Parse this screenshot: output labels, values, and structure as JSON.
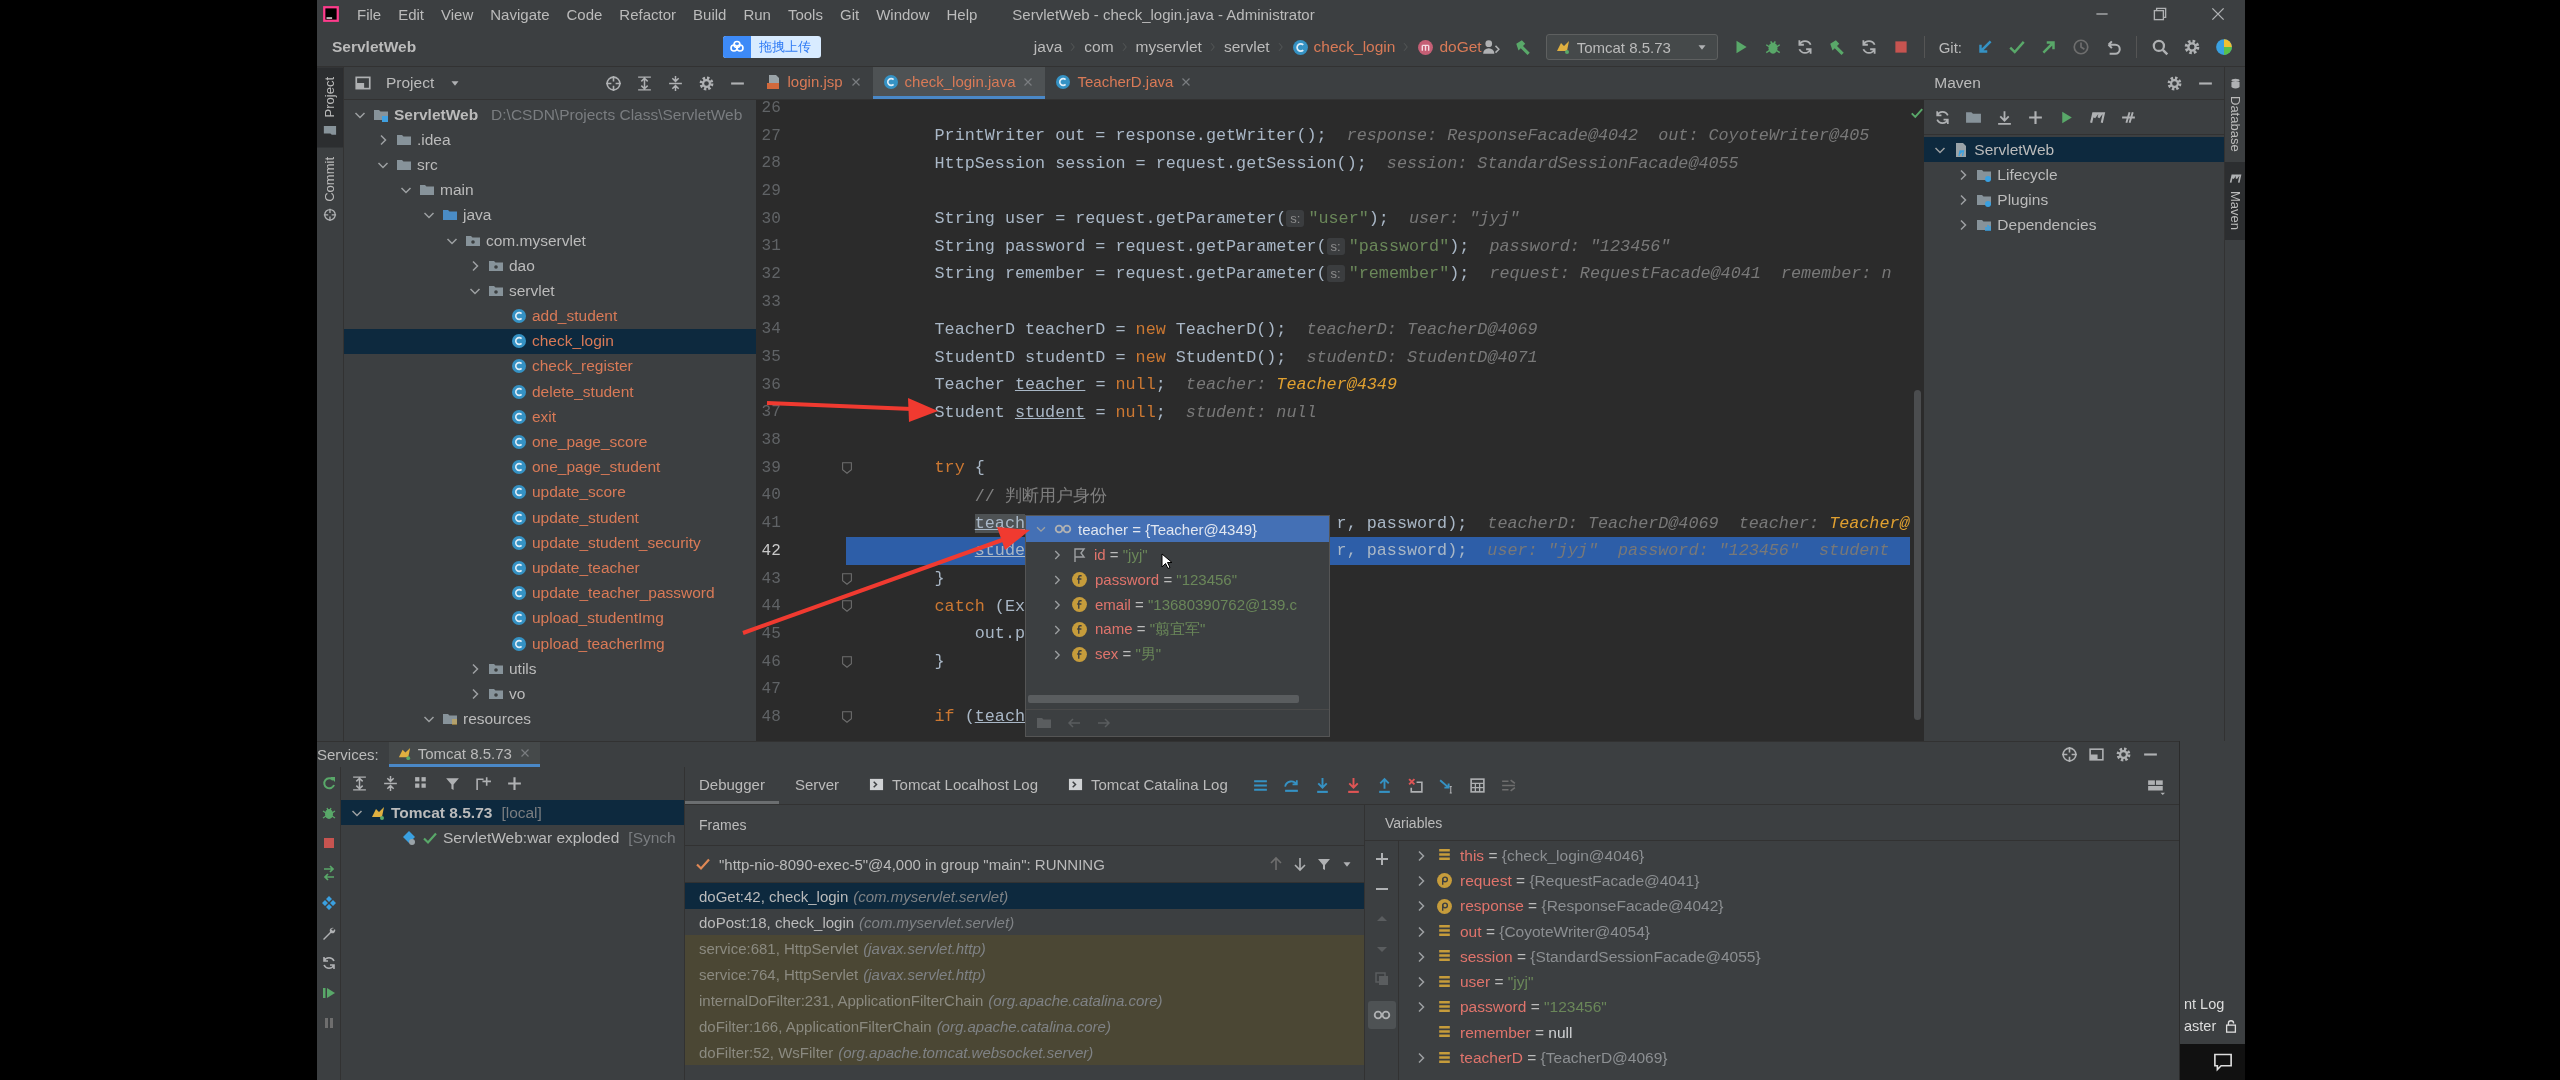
{
  "menu": {
    "items": [
      "File",
      "Edit",
      "View",
      "Navigate",
      "Code",
      "Refactor",
      "Build",
      "Run",
      "Tools",
      "Git",
      "Window",
      "Help"
    ]
  },
  "window": {
    "title": "ServletWeb - check_login.java - Administrator"
  },
  "breadcrumbs": [
    {
      "label": "ServletWeb",
      "kind": "project"
    },
    {
      "label": "java",
      "kind": "folder"
    },
    {
      "label": "com",
      "kind": "folder"
    },
    {
      "label": "myservlet",
      "kind": "folder"
    },
    {
      "label": "servlet",
      "kind": "folder"
    },
    {
      "label": "check_login",
      "kind": "class"
    },
    {
      "label": "doGet",
      "kind": "method"
    }
  ],
  "upload_overlay": {
    "label": "拖拽上传"
  },
  "run_config": {
    "label": "Tomcat 8.5.73"
  },
  "git": {
    "label": "Git:"
  },
  "left_stripe": [
    {
      "label": "Project",
      "selected": true
    },
    {
      "label": "Commit",
      "selected": false
    }
  ],
  "project": {
    "title": "Project",
    "tree": [
      {
        "label": "ServletWeb",
        "path": "D:\\CSDN\\Projects Class\\ServletWeb",
        "kind": "module",
        "expanded": true,
        "selected": false,
        "children": [
          {
            "label": ".idea",
            "kind": "folder",
            "expanded": false,
            "selected": false
          },
          {
            "label": "src",
            "kind": "folder",
            "expanded": true,
            "selected": false,
            "children": [
              {
                "label": "main",
                "kind": "folder",
                "expanded": true,
                "selected": false,
                "children": [
                  {
                    "label": "java",
                    "kind": "source",
                    "expanded": true,
                    "selected": false,
                    "children": [
                      {
                        "label": "com.myservlet",
                        "kind": "package",
                        "expanded": true,
                        "selected": false,
                        "children": [
                          {
                            "label": "dao",
                            "kind": "package",
                            "expanded": false,
                            "selected": false
                          },
                          {
                            "label": "servlet",
                            "kind": "package",
                            "expanded": true,
                            "selected": false,
                            "children": [
                              {
                                "label": "add_student",
                                "kind": "class",
                                "selected": false
                              },
                              {
                                "label": "check_login",
                                "kind": "class",
                                "selected": true
                              },
                              {
                                "label": "check_register",
                                "kind": "class",
                                "selected": false
                              },
                              {
                                "label": "delete_student",
                                "kind": "class",
                                "selected": false
                              },
                              {
                                "label": "exit",
                                "kind": "class",
                                "selected": false
                              },
                              {
                                "label": "one_page_score",
                                "kind": "class",
                                "selected": false
                              },
                              {
                                "label": "one_page_student",
                                "kind": "class",
                                "selected": false
                              },
                              {
                                "label": "update_score",
                                "kind": "class",
                                "selected": false
                              },
                              {
                                "label": "update_student",
                                "kind": "class",
                                "selected": false
                              },
                              {
                                "label": "update_student_security",
                                "kind": "class",
                                "selected": false
                              },
                              {
                                "label": "update_teacher",
                                "kind": "class",
                                "selected": false
                              },
                              {
                                "label": "update_teacher_password",
                                "kind": "class",
                                "selected": false
                              },
                              {
                                "label": "upload_studentImg",
                                "kind": "class",
                                "selected": false
                              },
                              {
                                "label": "upload_teacherImg",
                                "kind": "class",
                                "selected": false
                              }
                            ]
                          },
                          {
                            "label": "utils",
                            "kind": "package",
                            "expanded": false,
                            "selected": false
                          },
                          {
                            "label": "vo",
                            "kind": "package",
                            "expanded": false,
                            "selected": false
                          }
                        ]
                      }
                    ]
                  },
                  {
                    "label": "resources",
                    "kind": "resources",
                    "expanded": true,
                    "selected": false
                  }
                ]
              }
            ]
          }
        ]
      }
    ]
  },
  "editor_tabs": [
    {
      "label": "login.jsp",
      "kind": "jsp",
      "selected": false
    },
    {
      "label": "check_login.java",
      "kind": "class",
      "selected": true
    },
    {
      "label": "TeacherD.java",
      "kind": "class",
      "selected": false
    }
  ],
  "editor": {
    "lines": [
      {
        "number": "26",
        "current": false,
        "fold": false,
        "nested": false
      },
      {
        "number": "27",
        "current": false,
        "fold": false,
        "nested": false,
        "segments": [
          {
            "kind": "plain",
            "text": "PrintWriter out = response.getWriter();"
          },
          {
            "kind": "hint",
            "text": "response: ResponseFacade@4042"
          },
          {
            "kind": "hint",
            "text": "out: CoyoteWriter@405"
          }
        ]
      },
      {
        "number": "28",
        "current": false,
        "fold": false,
        "nested": false,
        "segments": [
          {
            "kind": "plain",
            "text": "HttpSession session = request.getSession();"
          },
          {
            "kind": "hint",
            "text": "session: StandardSessionFacade@4055"
          }
        ]
      },
      {
        "number": "29",
        "current": false,
        "fold": false,
        "nested": false
      },
      {
        "number": "30",
        "current": false,
        "fold": false,
        "nested": false,
        "segments": [
          {
            "kind": "plain",
            "text": "String user = request.getParameter("
          },
          {
            "kind": "param",
            "text": "s:"
          },
          {
            "kind": "string",
            "text": "\"user\""
          },
          {
            "kind": "plain",
            "text": ");"
          },
          {
            "kind": "hint",
            "text": "user: \"jyj\""
          }
        ]
      },
      {
        "number": "31",
        "current": false,
        "fold": false,
        "nested": false,
        "segments": [
          {
            "kind": "plain",
            "text": "String password = request.getParameter("
          },
          {
            "kind": "param",
            "text": "s:"
          },
          {
            "kind": "string",
            "text": "\"password\""
          },
          {
            "kind": "plain",
            "text": ");"
          },
          {
            "kind": "hint",
            "text": "password: \"123456\""
          }
        ]
      },
      {
        "number": "32",
        "current": false,
        "fold": false,
        "nested": false,
        "segments": [
          {
            "kind": "plain",
            "text": "String remember = request.getParameter("
          },
          {
            "kind": "param",
            "text": "s:"
          },
          {
            "kind": "string",
            "text": "\"remember\""
          },
          {
            "kind": "plain",
            "text": ");"
          },
          {
            "kind": "hint",
            "text": "request: RequestFacade@4041"
          },
          {
            "kind": "hint",
            "text": "remember: n"
          }
        ]
      },
      {
        "number": "33",
        "current": false,
        "fold": false,
        "nested": false
      },
      {
        "number": "34",
        "current": false,
        "fold": false,
        "nested": false,
        "segments": [
          {
            "kind": "plain",
            "text": "TeacherD teacherD = "
          },
          {
            "kind": "keyword",
            "text": "new"
          },
          {
            "kind": "plain",
            "text": " TeacherD();"
          },
          {
            "kind": "hint",
            "text": "teacherD: TeacherD@4069"
          }
        ]
      },
      {
        "number": "35",
        "current": false,
        "fold": false,
        "nested": false,
        "segments": [
          {
            "kind": "plain",
            "text": "StudentD studentD = "
          },
          {
            "kind": "keyword",
            "text": "new"
          },
          {
            "kind": "plain",
            "text": " StudentD();"
          },
          {
            "kind": "hint",
            "text": "studentD: StudentD@4071"
          }
        ]
      },
      {
        "number": "36",
        "current": false,
        "fold": false,
        "nested": false,
        "segments": [
          {
            "kind": "plain",
            "text": "Teacher "
          },
          {
            "kind": "usage",
            "text": "teacher"
          },
          {
            "kind": "plain",
            "text": " = "
          },
          {
            "kind": "keyword",
            "text": "null"
          },
          {
            "kind": "plain",
            "text": ";"
          },
          {
            "kind": "hint",
            "text": "teacher: "
          },
          {
            "kind": "hint_value",
            "text": "Teacher@4349"
          }
        ]
      },
      {
        "number": "37",
        "current": false,
        "fold": false,
        "nested": false,
        "segments": [
          {
            "kind": "plain",
            "text": "Student "
          },
          {
            "kind": "usage",
            "text": "student"
          },
          {
            "kind": "plain",
            "text": " = "
          },
          {
            "kind": "keyword",
            "text": "null"
          },
          {
            "kind": "plain",
            "text": ";"
          },
          {
            "kind": "hint",
            "text": "student: null"
          }
        ]
      },
      {
        "number": "38",
        "current": false,
        "fold": false,
        "nested": false
      },
      {
        "number": "39",
        "current": false,
        "fold": true,
        "nested": false,
        "segments": [
          {
            "kind": "keyword",
            "text": "try"
          },
          {
            "kind": "plain",
            "text": " {"
          }
        ]
      },
      {
        "number": "40",
        "current": false,
        "fold": false,
        "nested": true,
        "segments": [
          {
            "kind": "comment",
            "text": "// 判断用户身份"
          }
        ]
      },
      {
        "number": "41",
        "current": false,
        "fold": false,
        "nested": true,
        "segments": [
          {
            "kind": "usage_highlight",
            "text": "teach"
          }
        ],
        "after": [
          {
            "kind": "plain",
            "text": "r, password);"
          },
          {
            "kind": "hint",
            "text": "teacherD: TeacherD@4069"
          },
          {
            "kind": "hint",
            "text": "teacher: "
          },
          {
            "kind": "hint_value",
            "text": "Teacher@"
          }
        ]
      },
      {
        "number": "42",
        "current": true,
        "fold": false,
        "nested": true,
        "segments": [
          {
            "kind": "usage",
            "text": "stude"
          }
        ],
        "after": [
          {
            "kind": "plain",
            "text": "r, password);"
          },
          {
            "kind": "hint",
            "text": "user: \"jyj\""
          },
          {
            "kind": "hint",
            "text": "password: \"123456\""
          },
          {
            "kind": "hint",
            "text": "student"
          }
        ]
      },
      {
        "number": "43",
        "current": false,
        "fold": true,
        "nested": false,
        "segments": [
          {
            "kind": "plain",
            "text": "}"
          }
        ]
      },
      {
        "number": "44",
        "current": false,
        "fold": true,
        "nested": false,
        "segments": [
          {
            "kind": "keyword",
            "text": "catch"
          },
          {
            "kind": "plain",
            "text": " (Ex"
          }
        ]
      },
      {
        "number": "45",
        "current": false,
        "fold": false,
        "nested": true,
        "segments": [
          {
            "kind": "plain",
            "text": "out.p"
          }
        ]
      },
      {
        "number": "46",
        "current": false,
        "fold": true,
        "nested": false,
        "segments": [
          {
            "kind": "plain",
            "text": "}"
          }
        ]
      },
      {
        "number": "47",
        "current": false,
        "fold": false,
        "nested": false
      },
      {
        "number": "48",
        "current": false,
        "fold": true,
        "nested": false,
        "segments": [
          {
            "kind": "keyword",
            "text": "if"
          },
          {
            "kind": "plain",
            "text": " ("
          },
          {
            "kind": "usage",
            "text": "teach"
          }
        ]
      }
    ]
  },
  "value_popup": {
    "title": "teacher = {Teacher@4349}",
    "fields": [
      {
        "name": "id",
        "sign": "=",
        "value": "\"jyj\"",
        "kind": "flag"
      },
      {
        "name": "password",
        "sign": "=",
        "value": "\"123456\"",
        "kind": "field"
      },
      {
        "name": "email",
        "sign": "=",
        "value": "\"13680390762@139.c",
        "kind": "field"
      },
      {
        "name": "name",
        "sign": "=",
        "value": "\"翦宜军\"",
        "kind": "field"
      },
      {
        "name": "sex",
        "sign": "=",
        "value": "\"男\"",
        "kind": "field"
      }
    ]
  },
  "maven": {
    "title": "Maven",
    "tree": [
      {
        "label": "ServletWeb",
        "kind": "project",
        "expanded": true,
        "selected": true,
        "children": [
          {
            "label": "Lifecycle",
            "kind": "lifecycle",
            "expanded": false,
            "selected": false
          },
          {
            "label": "Plugins",
            "kind": "plugins",
            "expanded": false,
            "selected": false
          },
          {
            "label": "Dependencies",
            "kind": "dependencies",
            "expanded": false,
            "selected": false
          }
        ]
      }
    ]
  },
  "right_stripe": [
    {
      "label": "Database",
      "selected": false
    },
    {
      "label": "Maven",
      "selected": true
    }
  ],
  "services": {
    "label": "Services:",
    "tabs": [
      {
        "label": "Tomcat 8.5.73",
        "selected": true
      }
    ],
    "tree": [
      {
        "label": "Tomcat 8.5.73",
        "suffix": "[local]",
        "expanded": true,
        "selected": true,
        "children": [
          {
            "label": "ServletWeb:war exploded",
            "suffix": "[Synch",
            "selected": false
          }
        ]
      }
    ]
  },
  "debugger": {
    "tabs": [
      {
        "label": "Debugger",
        "kind": "plain",
        "selected": true
      },
      {
        "label": "Server",
        "kind": "plain",
        "selected": false
      },
      {
        "label": "Tomcat Localhost Log",
        "kind": "log",
        "selected": false
      },
      {
        "label": "Tomcat Catalina Log",
        "kind": "log",
        "selected": false
      }
    ],
    "frames_title": "Frames",
    "thread": "\"http-nio-8090-exec-5\"@4,000 in group \"main\": RUNNING",
    "frames": [
      {
        "method": "doGet:42, check_login",
        "package": "(com.myservlet.servlet)",
        "kind": "user",
        "selected": true
      },
      {
        "method": "doPost:18, check_login",
        "package": "(com.myservlet.servlet)",
        "kind": "user",
        "selected": false
      },
      {
        "method": "service:681, HttpServlet",
        "package": "(javax.servlet.http)",
        "kind": "library",
        "selected": false
      },
      {
        "method": "service:764, HttpServlet",
        "package": "(javax.servlet.http)",
        "kind": "library",
        "selected": false
      },
      {
        "method": "internalDoFilter:231, ApplicationFilterChain",
        "package": "(org.apache.catalina.core)",
        "kind": "library",
        "selected": false
      },
      {
        "method": "doFilter:166, ApplicationFilterChain",
        "package": "(org.apache.catalina.core)",
        "kind": "library",
        "selected": false
      },
      {
        "method": "doFilter:52, WsFilter",
        "package": "(org.apache.tomcat.websocket.server)",
        "kind": "library",
        "selected": false
      }
    ],
    "variables_title": "Variables",
    "variables": [
      {
        "name": "this",
        "sign": "=",
        "value": "{check_login@4046}",
        "kind": "local_object",
        "expandable": true
      },
      {
        "name": "request",
        "sign": "=",
        "value": "{RequestFacade@4041}",
        "kind": "param_object",
        "expandable": true
      },
      {
        "name": "response",
        "sign": "=",
        "value": "{ResponseFacade@4042}",
        "kind": "param_object",
        "expandable": true
      },
      {
        "name": "out",
        "sign": "=",
        "value": "{CoyoteWriter@4054}",
        "kind": "local_object",
        "expandable": true
      },
      {
        "name": "session",
        "sign": "=",
        "value": "{StandardSessionFacade@4055}",
        "kind": "local_object",
        "expandable": true
      },
      {
        "name": "user",
        "sign": "=",
        "value": "\"jyj\"",
        "kind": "local_string",
        "expandable": true
      },
      {
        "name": "password",
        "sign": "=",
        "value": "\"123456\"",
        "kind": "local_string",
        "expandable": true
      },
      {
        "name": "remember",
        "sign": "=",
        "value": "null",
        "kind": "local_null",
        "expandable": false
      },
      {
        "name": "teacherD",
        "sign": "=",
        "value": "{TeacherD@4069}",
        "kind": "local_object",
        "expandable": true
      }
    ]
  },
  "background_window": {
    "texts": [
      "nt Log",
      "aster"
    ]
  }
}
